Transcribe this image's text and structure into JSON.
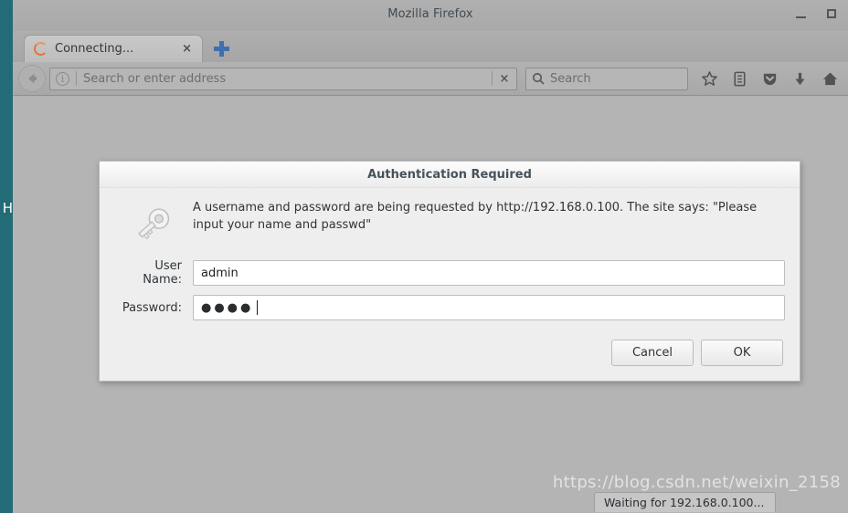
{
  "window": {
    "title": "Mozilla Firefox",
    "minimize_label": "minimize",
    "maximize_label": "maximize"
  },
  "tabs": [
    {
      "title": "Connecting...",
      "close_label": "×",
      "loading": true
    }
  ],
  "newtab": {
    "label": "+"
  },
  "toolbar": {
    "back_label": "Back",
    "identity_icon_glyph": "i",
    "url_placeholder": "Search or enter address",
    "url_value": "",
    "url_clear_label": "×",
    "search_placeholder": "Search",
    "search_value": "",
    "icons": [
      {
        "name": "bookmark-star-icon",
        "label": "Bookmark this page"
      },
      {
        "name": "library-icon",
        "label": "Show your library"
      },
      {
        "name": "pocket-icon",
        "label": "Save to Pocket"
      },
      {
        "name": "downloads-icon",
        "label": "Downloads"
      },
      {
        "name": "home-icon",
        "label": "Home"
      }
    ]
  },
  "dialog": {
    "title": "Authentication Required",
    "icon": "key-icon",
    "message": "A username and password are being requested by http://192.168.0.100. The site says: \"Please input your name and passwd\"",
    "fields": [
      {
        "label": "User Name:",
        "value": "admin",
        "type": "text",
        "name": "username-field"
      },
      {
        "label": "Password:",
        "value": "●●●●",
        "type": "password",
        "name": "password-field"
      }
    ],
    "cancel_label": "Cancel",
    "ok_label": "OK"
  },
  "statusbar": {
    "text": "Waiting for 192.168.0.100..."
  },
  "watermark": {
    "text": "https://blog.csdn.net/weixin_2158"
  },
  "desktop": {
    "clipped_label": "H"
  },
  "colors": {
    "desktop_teal": "#236b76",
    "chrome_gray": "#b0b0b0",
    "content_gray": "#b4b4b4",
    "dialog_bg": "#eeeeee",
    "title_text": "#45525c",
    "spinner_orange": "#e8713a",
    "newtab_blue": "#3f6fae"
  }
}
